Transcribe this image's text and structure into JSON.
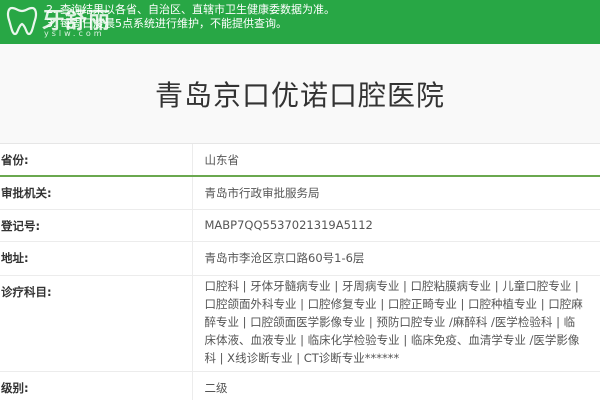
{
  "notice": {
    "line1": "2. 查询结果以各省、自治区、直辖市卫生健康委数据为准。",
    "line2": "3. 每周日凌晨5点系统进行维护，不能提供查询。"
  },
  "logo": {
    "brand": "牙舒丽",
    "url": "yslw.com"
  },
  "hospital": {
    "name": "青岛京口优诺口腔医院"
  },
  "info": {
    "province_label": "省份:",
    "province_value": "山东省",
    "authority_label": "审批机关:",
    "authority_value": "青岛市行政审批服务局",
    "reg_label": "登记号:",
    "reg_value": "MABP7QQ5537021319A5112",
    "address_label": "地址:",
    "address_value": "青岛市李沧区京口路60号1-6层",
    "subjects_label": "诊疗科目:",
    "subjects_value": "口腔科 | 牙体牙髓病专业 | 牙周病专业 | 口腔粘膜病专业 | 儿童口腔专业 | 口腔颌面外科专业 | 口腔修复专业 | 口腔正畸专业 | 口腔种植专业 | 口腔麻醉专业 | 口腔颌面医学影像专业 | 预防口腔专业 /麻醉科 /医学检验科 | 临床体液、血液专业 | 临床化学检验专业 | 临床免疫、血清学专业 /医学影像科 | X线诊断专业 | CT诊断专业******",
    "level_label": "级别:",
    "level_value": "二级"
  },
  "colors": {
    "notice_bg": "#28a745",
    "divider_accent": "#6aa84f"
  }
}
